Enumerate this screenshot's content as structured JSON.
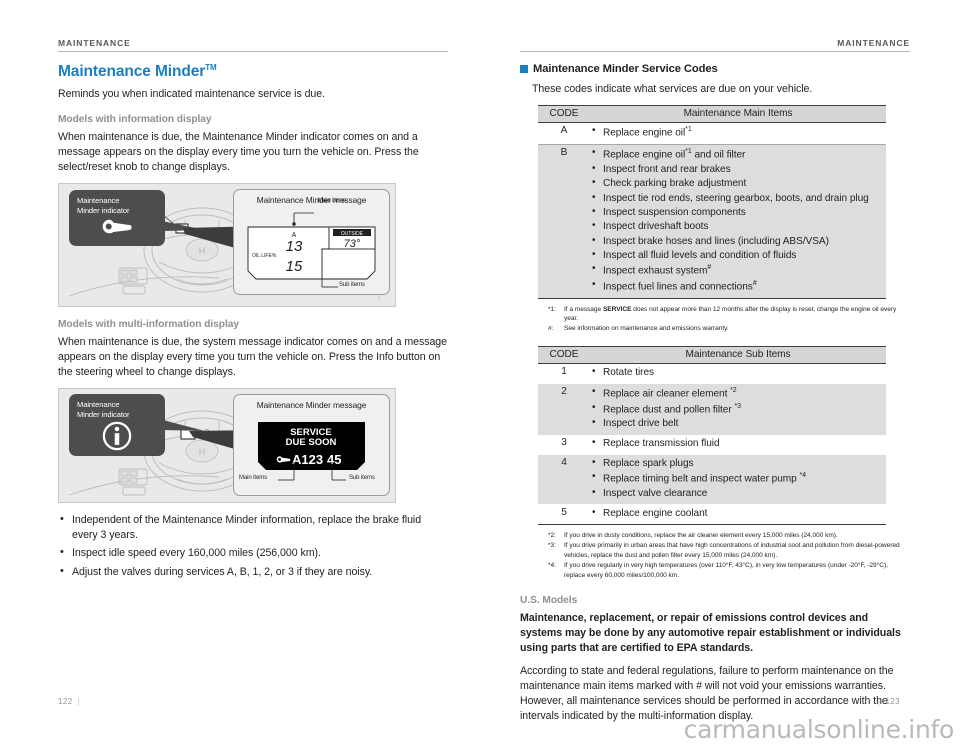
{
  "left_page": {
    "running_head": "MAINTENANCE",
    "page_number": "122",
    "title": "Maintenance Minder",
    "title_sup": "TM",
    "intro": "Reminds you when indicated maintenance service is due.",
    "section_1": {
      "subhead": "Models with information display",
      "body": "When maintenance is due, the Maintenance Minder indicator comes on and a message appears on the display every time you turn the vehicle on. Press the select/reset knob to change displays.",
      "illustration": {
        "callout_line1": "Maintenance",
        "callout_line2": "Minder indicator",
        "callout_icon": "wrench-icon",
        "panel_title": "Maintenance Minder message",
        "label_main": "Main items",
        "label_sub": "Sub items",
        "lcd_code": "A",
        "lcd_main": "13",
        "lcd_sub": "15",
        "lcd_outside_label": "OUTSIDE",
        "lcd_temp": "73°",
        "lcd_oil_life": "OIL LIFE%"
      }
    },
    "section_2": {
      "subhead": "Models with multi-information display",
      "body": "When maintenance is due, the system message indicator comes on and a message appears on the display every time you turn the vehicle on. Press the Info button on the steering wheel to change displays.",
      "illustration": {
        "callout_line1": "Maintenance",
        "callout_line2": "Minder indicator",
        "callout_icon": "info-icon",
        "panel_title": "Maintenance Minder message",
        "label_main": "Main items",
        "label_sub": "Sub items",
        "lcd_line1": "SERVICE",
        "lcd_line2": "DUE SOON",
        "lcd_code": "A123",
        "lcd_code_tail": "45",
        "lcd_icon": "wrench-icon"
      }
    },
    "bullets": [
      "Independent of the Maintenance Minder information, replace the brake fluid every 3 years.",
      "Inspect idle speed every 160,000 miles (256,000 km).",
      "Adjust the valves during services A, B, 1, 2, or 3 if they are noisy."
    ]
  },
  "right_page": {
    "running_head": "MAINTENANCE",
    "page_number": "123",
    "section_title": "Maintenance Minder Service Codes",
    "section_intro": "These codes indicate what services are due on your vehicle.",
    "main_table": {
      "header_code": "CODE",
      "header_items": "Maintenance Main Items",
      "rows": [
        {
          "code": "A",
          "shaded": false,
          "items": [
            {
              "text": "Replace engine oil",
              "sup": "*1"
            }
          ]
        },
        {
          "code": "B",
          "shaded": true,
          "items": [
            {
              "text": "Replace engine oil",
              "sup": "*1",
              "after": " and oil filter"
            },
            {
              "text": "Inspect front and rear brakes"
            },
            {
              "text": "Check parking brake adjustment"
            },
            {
              "text": "Inspect tie rod ends, steering gearbox, boots, and drain plug"
            },
            {
              "text": "Inspect suspension components"
            },
            {
              "text": "Inspect driveshaft boots"
            },
            {
              "text": "Inspect brake hoses and lines (including ABS/VSA)"
            },
            {
              "text": "Inspect all fluid levels and condition of fluids"
            },
            {
              "text": "Inspect exhaust system",
              "sup": "#"
            },
            {
              "text": "Inspect fuel lines and connections",
              "sup": "#"
            }
          ]
        }
      ]
    },
    "main_footnotes": [
      {
        "key": "*1:",
        "pre": "If a message ",
        "bold": "SERVICE",
        "post": " does not appear more than 12 months after the display is reset, change the engine oil every year."
      },
      {
        "key": "#:",
        "pre": "See information on maintenance and emissions warranty.",
        "bold": "",
        "post": ""
      }
    ],
    "sub_table": {
      "header_code": "CODE",
      "header_items": "Maintenance Sub Items",
      "rows": [
        {
          "code": "1",
          "shaded": false,
          "items": [
            {
              "text": "Rotate tires"
            }
          ]
        },
        {
          "code": "2",
          "shaded": true,
          "items": [
            {
              "text": "Replace air cleaner element ",
              "sup": "*2"
            },
            {
              "text": "Replace dust and pollen filter ",
              "sup": "*3"
            },
            {
              "text": "Inspect drive belt"
            }
          ]
        },
        {
          "code": "3",
          "shaded": false,
          "items": [
            {
              "text": "Replace transmission fluid"
            }
          ]
        },
        {
          "code": "4",
          "shaded": true,
          "items": [
            {
              "text": "Replace spark plugs"
            },
            {
              "text": "Replace timing belt and inspect water pump ",
              "sup": "*4"
            },
            {
              "text": "Inspect valve clearance"
            }
          ]
        },
        {
          "code": "5",
          "shaded": false,
          "items": [
            {
              "text": "Replace engine coolant"
            }
          ]
        }
      ]
    },
    "sub_footnotes": [
      {
        "key": "*2:",
        "text": "If you drive in dusty conditions, replace the air cleaner element every 15,000 miles (24,000 km)."
      },
      {
        "key": "*3:",
        "text": "If you drive primarily in urban areas that have high concentrations of industrial soot and pollution from diesel-powered vehicles, replace the dust and pollen filter every 15,000 miles (24,000 km)."
      },
      {
        "key": "*4:",
        "text": "If you drive regularly in very high temperatures (over 110°F, 43°C), in very low temperatures (under -20°F, -29°C), replace every 60,000 miles/100,000 km."
      }
    ],
    "us_models": {
      "subhead": "U.S. Models",
      "bold_text": "Maintenance, replacement, or repair of emissions control devices and systems may be done by any automotive repair establishment or individuals using parts that are certified to EPA standards.",
      "body_text": "According to state and federal regulations, failure to perform maintenance on the maintenance main items marked with # will not void your emissions warranties. However, all maintenance services should be performed in accordance with the intervals indicated by the multi-information display."
    }
  },
  "watermark": "carmanualsonline.info",
  "colors": {
    "accent_blue": "#1a7fc1",
    "table_header": "#d5d6d6",
    "row_shade": "#dcdddd",
    "callout_bg": "#4d4d4f",
    "illus_bg": "#e9e9e9",
    "muted_text": "#8d9093"
  }
}
